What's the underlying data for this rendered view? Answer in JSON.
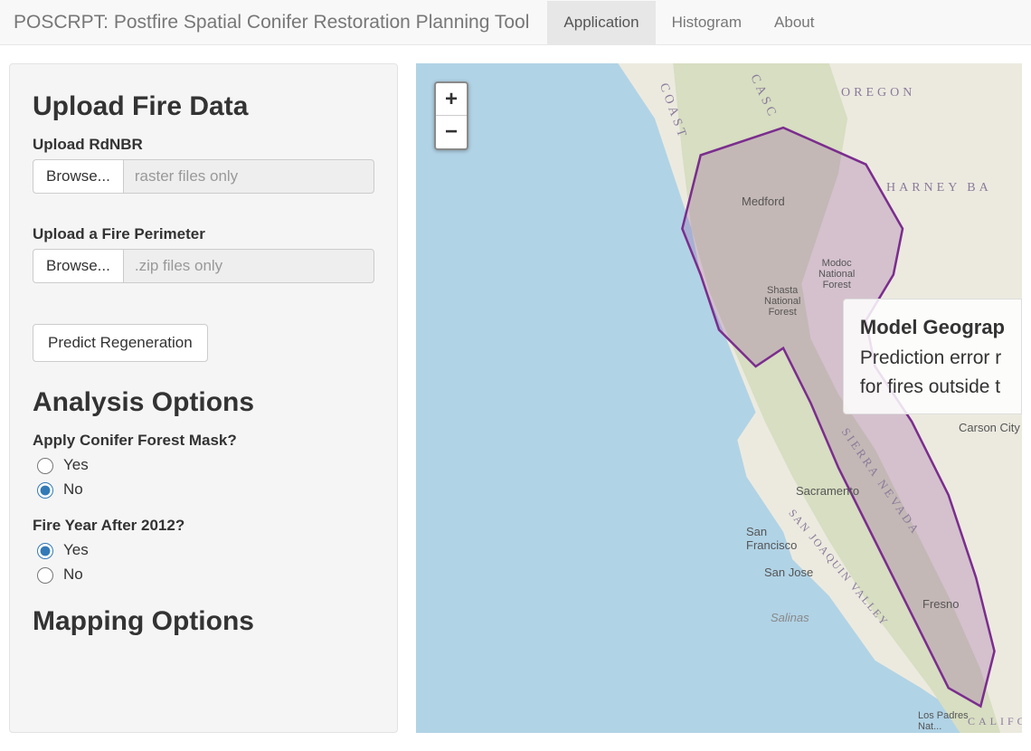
{
  "navbar": {
    "title": "POSCRPT: Postfire Spatial Conifer Restoration Planning Tool",
    "tabs": [
      {
        "label": "Application",
        "active": true
      },
      {
        "label": "Histogram",
        "active": false
      },
      {
        "label": "About",
        "active": false
      }
    ]
  },
  "sidebar": {
    "upload_heading": "Upload Fire Data",
    "rdnbr": {
      "label": "Upload RdNBR",
      "browse": "Browse...",
      "placeholder": "raster files only"
    },
    "perimeter": {
      "label": "Upload a Fire Perimeter",
      "browse": "Browse...",
      "placeholder": ".zip files only"
    },
    "predict_btn": "Predict Regeneration",
    "analysis_heading": "Analysis Options",
    "conifer_mask": {
      "label": "Apply Conifer Forest Mask?",
      "yes": "Yes",
      "no": "No",
      "value": "No"
    },
    "fire_year": {
      "label": "Fire Year After 2012?",
      "yes": "Yes",
      "no": "No",
      "value": "Yes"
    },
    "mapping_heading": "Mapping Options"
  },
  "map": {
    "zoom_in": "+",
    "zoom_out": "−",
    "info": {
      "title": "Model Geograp",
      "line1": "Prediction error r",
      "line2": "for fires outside t"
    },
    "labels": {
      "oregon": "OREGON",
      "harney": "HARNEY BA",
      "coast": "COAST",
      "casc": "CASC",
      "sierra": "SIERRA NEVADA",
      "sjv": "SAN JOAQUIN VALLEY",
      "calif": "CALIFO",
      "modoc": "Modoc\nNational\nForest",
      "shasta": "Shasta\nNational\nForest"
    },
    "cities": {
      "medford": "Medford",
      "sacramento": "Sacramento",
      "sf": "San\nFrancisco",
      "sj": "San Jose",
      "fresno": "Fresno",
      "carson": "Carson City",
      "salinas": "Salinas",
      "lospadres": "Los Padres\nNat..."
    }
  }
}
